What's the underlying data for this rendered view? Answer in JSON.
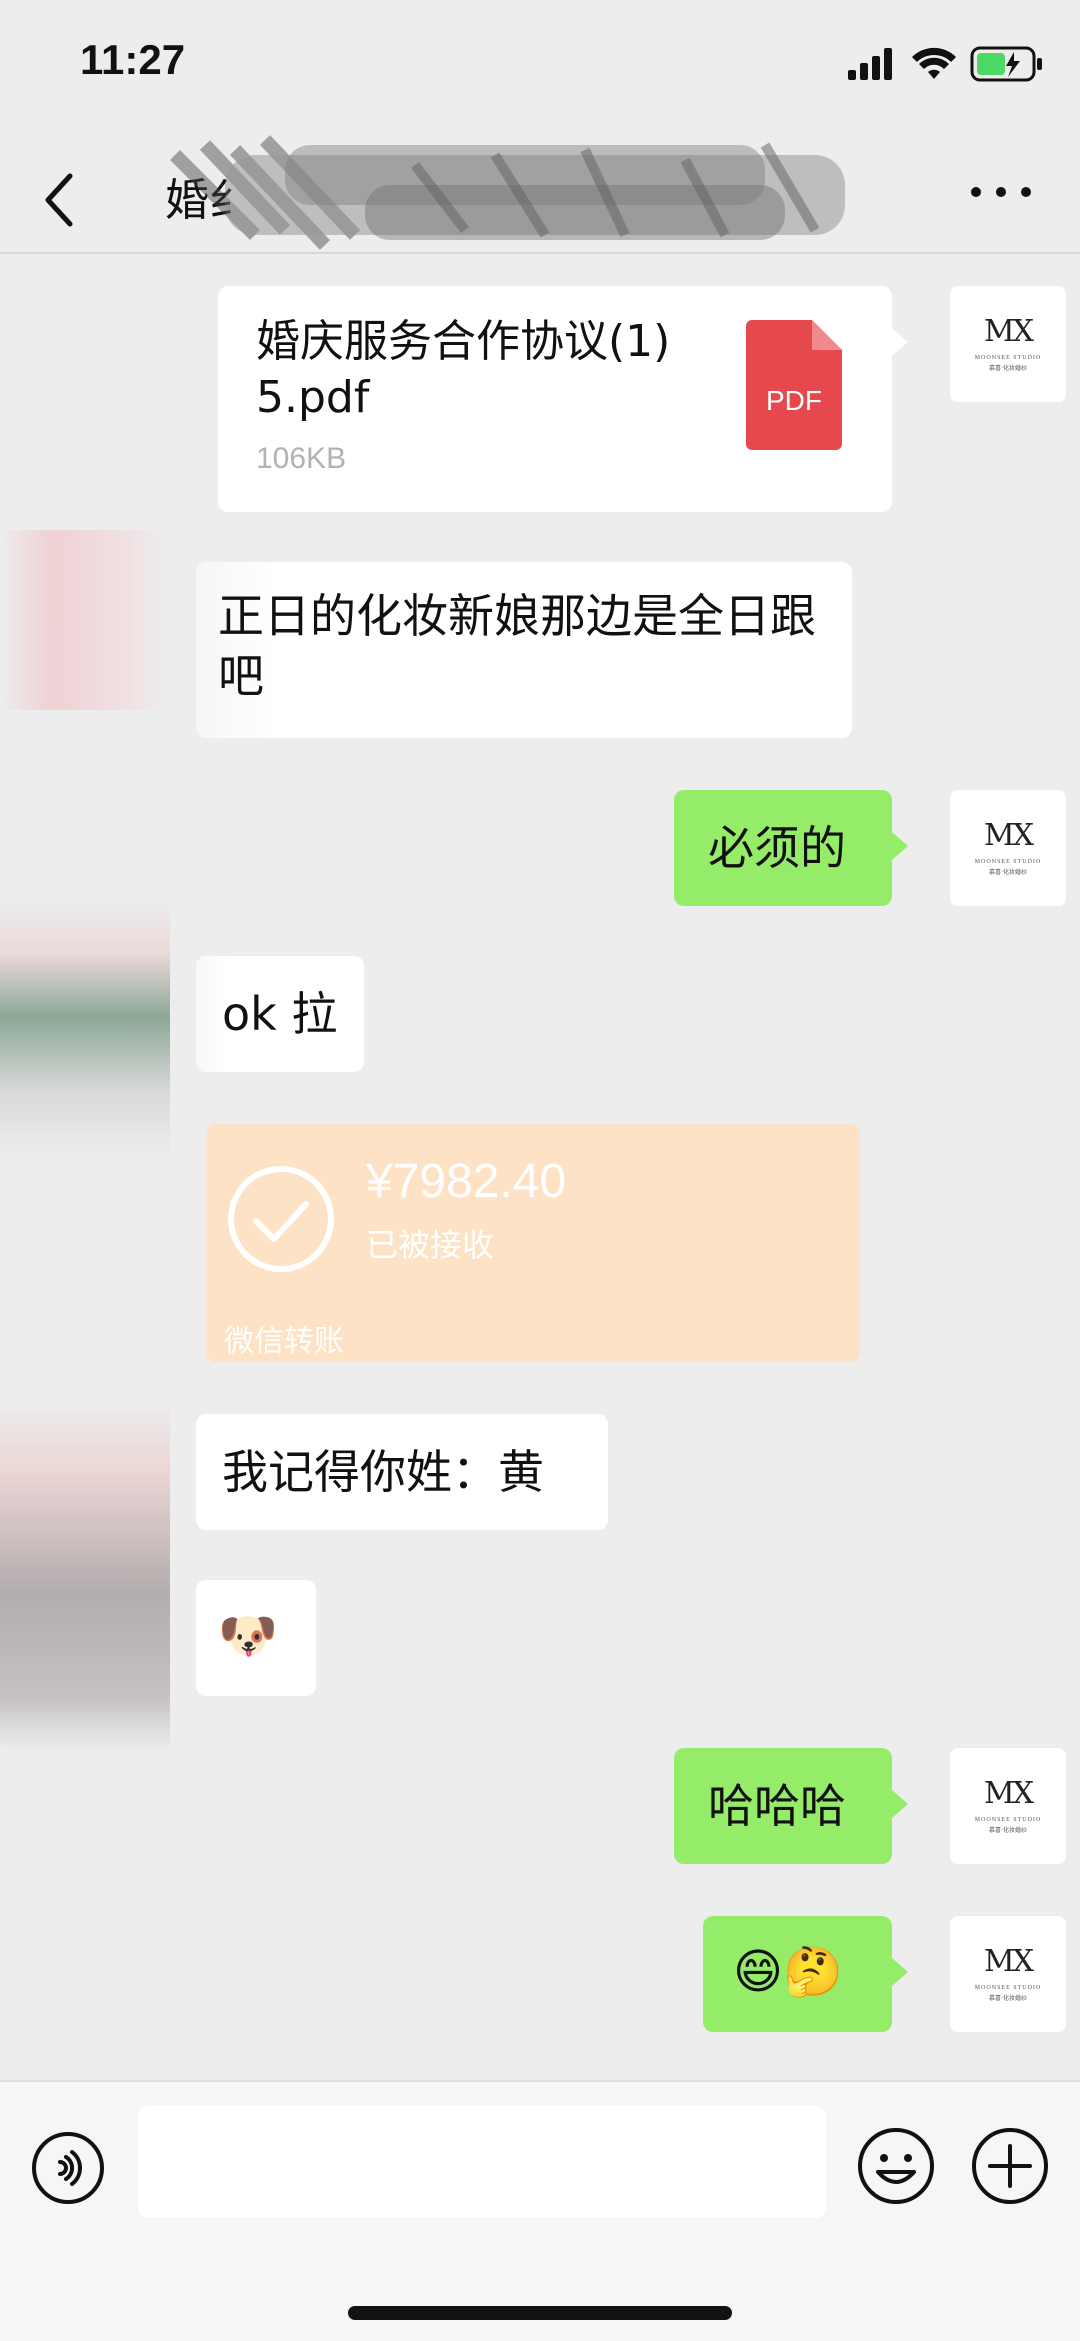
{
  "status_bar": {
    "time": "11:27"
  },
  "header": {
    "title": "婚纟"
  },
  "messages": {
    "file": {
      "name": "婚庆服务合作协议(1) 5.pdf",
      "size": "106KB",
      "type_label": "PDF"
    },
    "msg1": "正日的化妆新娘那边是全日跟吧",
    "msg2": "必须的",
    "msg3": "ok 拉",
    "transfer": {
      "amount": "¥7982.40",
      "status": "已被接收",
      "label": "微信转账"
    },
    "msg4": "我记得你姓：黄",
    "msg5_emoji": "🐶",
    "msg6": "哈哈哈",
    "msg7_emoji": "😄🤔"
  },
  "avatar": {
    "logo": "MX",
    "sub": "MOONSEE STUDIO",
    "sub2": "慕喜·化妆婚纱"
  },
  "colors": {
    "green_bubble": "#95ec69",
    "background": "#ededed",
    "transfer": "#fde2c5",
    "pdf_red": "#e5484d"
  },
  "icons": [
    "back-chevron-icon",
    "more-icon",
    "voice-icon",
    "emoji-icon",
    "plus-icon",
    "signal-icon",
    "wifi-icon",
    "battery-icon",
    "pdf-file-icon",
    "check-circle-icon"
  ]
}
